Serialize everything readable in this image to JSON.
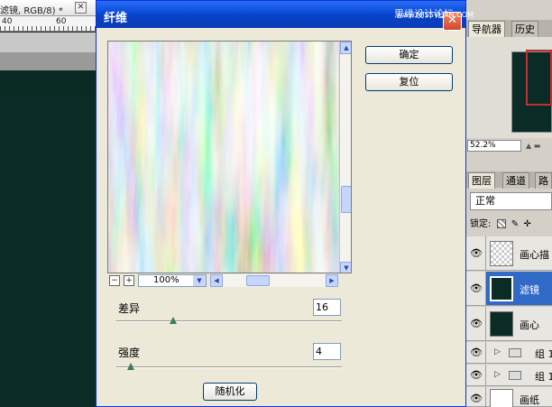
{
  "document": {
    "title": "滤镜, RGB/8) *",
    "close_glyph": "✕",
    "ruler_labels": [
      "40",
      "60"
    ]
  },
  "dialog": {
    "title": "纤维",
    "close_glyph": "✕",
    "watermark": "思缘设计论坛",
    "watermark_url": "www.MISSVUAN.COM",
    "ok_label": "确定",
    "reset_label": "复位",
    "zoom": {
      "minus": "−",
      "plus": "+",
      "value": "100%"
    },
    "variance": {
      "label": "差异",
      "value": "16",
      "max": 64
    },
    "strength": {
      "label": "强度",
      "value": "4",
      "max": 64
    },
    "randomize_label": "随机化"
  },
  "navigator": {
    "tabs": [
      "导航器",
      "历史"
    ],
    "zoom_value": "52.2%"
  },
  "layers": {
    "tabs": [
      "图层",
      "通道",
      "路"
    ],
    "blend_mode": "正常",
    "lock_label": "锁定:",
    "items": [
      {
        "name": "画心描",
        "thumb": "transparent",
        "selected": false
      },
      {
        "name": "滤镜",
        "thumb": "#0b2c26",
        "selected": true
      },
      {
        "name": "画心",
        "thumb": "#0b2c26",
        "selected": false
      },
      {
        "name": "组 1",
        "thumb": "group",
        "selected": false
      },
      {
        "name": "组 1",
        "thumb": "group",
        "selected": false
      },
      {
        "name": "画纸",
        "thumb": "white",
        "selected": false
      }
    ]
  }
}
